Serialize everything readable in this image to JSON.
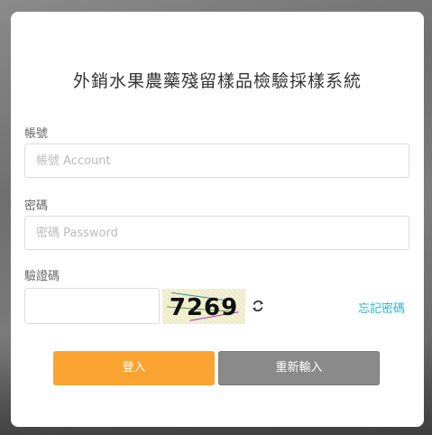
{
  "title": "外銷水果農藥殘留樣品檢驗採樣系統",
  "account": {
    "label": "帳號",
    "placeholder": "帳號 Account"
  },
  "password": {
    "label": "密碼",
    "placeholder": "密碼 Password"
  },
  "captcha": {
    "label": "驗證碼",
    "code": "7269",
    "refresh_icon": "refresh-icon"
  },
  "forgot_password": "忘記密碼",
  "buttons": {
    "login": "登入",
    "reset": "重新輸入"
  },
  "colors": {
    "accent": "#fca431",
    "link": "#29b6d8",
    "reset": "#8a8a8a"
  }
}
